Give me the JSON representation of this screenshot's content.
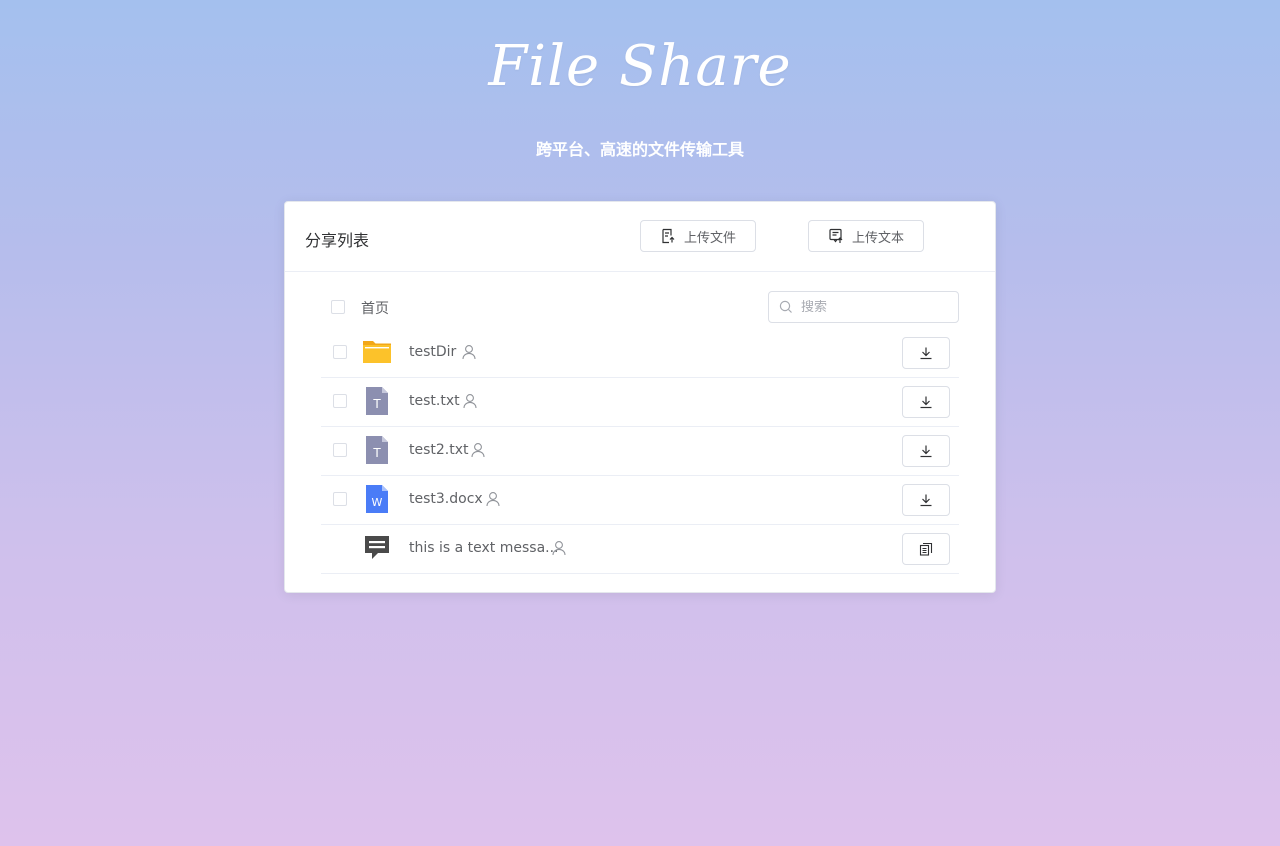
{
  "header": {
    "brand": "File Share",
    "tagline": "跨平台、高速的文件传输工具"
  },
  "card": {
    "title": "分享列表",
    "upload_file_label": "上传文件",
    "upload_text_label": "上传文本"
  },
  "toolbar": {
    "breadcrumb": "首页",
    "search_placeholder": "搜索"
  },
  "files": [
    {
      "name": "testDir",
      "type": "folder-icon",
      "action": "download-icon"
    },
    {
      "name": "test.txt",
      "type": "text-file-icon",
      "action": "download-icon"
    },
    {
      "name": "test2.txt",
      "type": "text-file-icon",
      "action": "download-icon"
    },
    {
      "name": "test3.docx",
      "type": "word-file-icon",
      "action": "download-icon"
    },
    {
      "name": "this is a text messa...",
      "type": "message-icon",
      "action": "copy-icon"
    }
  ],
  "colors": {
    "folder": "#fcc22a",
    "text_file": "#8c8fb0",
    "word_file": "#4a7cf7",
    "message": "#4a4a4a"
  }
}
